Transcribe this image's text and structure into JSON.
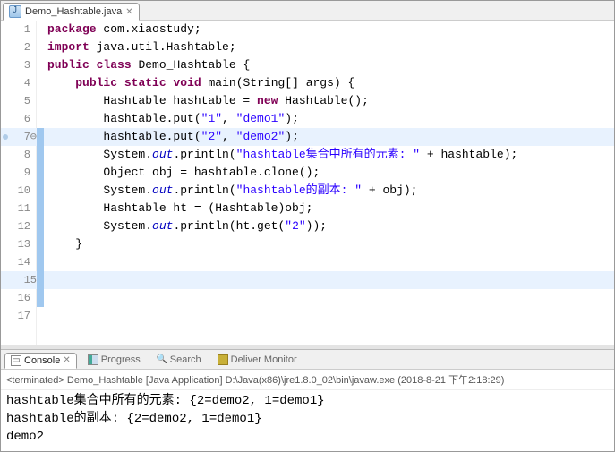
{
  "tab": {
    "title": "Demo_Hashtable.java"
  },
  "code": {
    "lines": [
      {
        "n": 1,
        "tokens": [
          [
            "kw",
            "package"
          ],
          [
            "plain",
            " com.xiaostudy;"
          ]
        ]
      },
      {
        "n": 2,
        "tokens": [
          [
            "plain",
            ""
          ]
        ]
      },
      {
        "n": 3,
        "tokens": [
          [
            "kw",
            "import"
          ],
          [
            "plain",
            " java.util.Hashtable;"
          ]
        ]
      },
      {
        "n": 4,
        "tokens": [
          [
            "plain",
            ""
          ]
        ]
      },
      {
        "n": 5,
        "tokens": [
          [
            "kw",
            "public"
          ],
          [
            "plain",
            " "
          ],
          [
            "kw",
            "class"
          ],
          [
            "plain",
            " Demo_Hashtable {"
          ]
        ]
      },
      {
        "n": 6,
        "tokens": [
          [
            "plain",
            ""
          ]
        ]
      },
      {
        "n": 7,
        "hl": true,
        "mark": true,
        "stripe": true,
        "line_display": "7",
        "sep": "⊖",
        "tokens": [
          [
            "plain",
            "    "
          ],
          [
            "kw",
            "public"
          ],
          [
            "plain",
            " "
          ],
          [
            "kw",
            "static"
          ],
          [
            "plain",
            " "
          ],
          [
            "kw",
            "void"
          ],
          [
            "plain",
            " main(String[] args) {"
          ]
        ]
      },
      {
        "n": 8,
        "stripe": true,
        "tokens": [
          [
            "plain",
            "        Hashtable hashtable = "
          ],
          [
            "kw",
            "new"
          ],
          [
            "plain",
            " Hashtable();"
          ]
        ]
      },
      {
        "n": 9,
        "stripe": true,
        "tokens": [
          [
            "plain",
            "        hashtable.put("
          ],
          [
            "st",
            "\"1\""
          ],
          [
            "plain",
            ", "
          ],
          [
            "st",
            "\"demo1\""
          ],
          [
            "plain",
            ");"
          ]
        ]
      },
      {
        "n": 10,
        "stripe": true,
        "tokens": [
          [
            "plain",
            "        hashtable.put("
          ],
          [
            "st",
            "\"2\""
          ],
          [
            "plain",
            ", "
          ],
          [
            "st",
            "\"demo2\""
          ],
          [
            "plain",
            ");"
          ]
        ]
      },
      {
        "n": 11,
        "stripe": true,
        "tokens": [
          [
            "plain",
            "        System."
          ],
          [
            "sf",
            "out"
          ],
          [
            "plain",
            ".println("
          ],
          [
            "st",
            "\"hashtable集合中所有的元素: \""
          ],
          [
            "plain",
            " + hashtable);"
          ]
        ]
      },
      {
        "n": 12,
        "stripe": true,
        "tokens": [
          [
            "plain",
            "        Object obj = hashtable.clone();"
          ]
        ]
      },
      {
        "n": 13,
        "stripe": true,
        "tokens": [
          [
            "plain",
            "        System."
          ],
          [
            "sf",
            "out"
          ],
          [
            "plain",
            ".println("
          ],
          [
            "st",
            "\"hashtable的副本: \""
          ],
          [
            "plain",
            " + obj);"
          ]
        ]
      },
      {
        "n": 14,
        "stripe": true,
        "tokens": [
          [
            "plain",
            "        Hashtable ht = (Hashtable)obj;"
          ]
        ]
      },
      {
        "n": 15,
        "hl": true,
        "stripe": true,
        "tokens": [
          [
            "plain",
            "        System."
          ],
          [
            "sf",
            "out"
          ],
          [
            "plain",
            ".println(ht.get("
          ],
          [
            "st",
            "\"2\""
          ],
          [
            "plain",
            "));"
          ]
        ]
      },
      {
        "n": 16,
        "stripe": true,
        "tokens": [
          [
            "plain",
            "    }"
          ]
        ]
      },
      {
        "n": 17,
        "tokens": [
          [
            "plain",
            ""
          ]
        ]
      }
    ]
  },
  "console": {
    "tabs": {
      "console": "Console",
      "progress": "Progress",
      "search": "Search",
      "deliver": "Deliver Monitor"
    },
    "header": "<terminated> Demo_Hashtable [Java Application] D:\\Java(x86)\\jre1.8.0_02\\bin\\javaw.exe (2018-8-21 下午2:18:29)",
    "out": [
      "hashtable集合中所有的元素: {2=demo2, 1=demo1}",
      "hashtable的副本: {2=demo2, 1=demo1}",
      "demo2"
    ]
  }
}
